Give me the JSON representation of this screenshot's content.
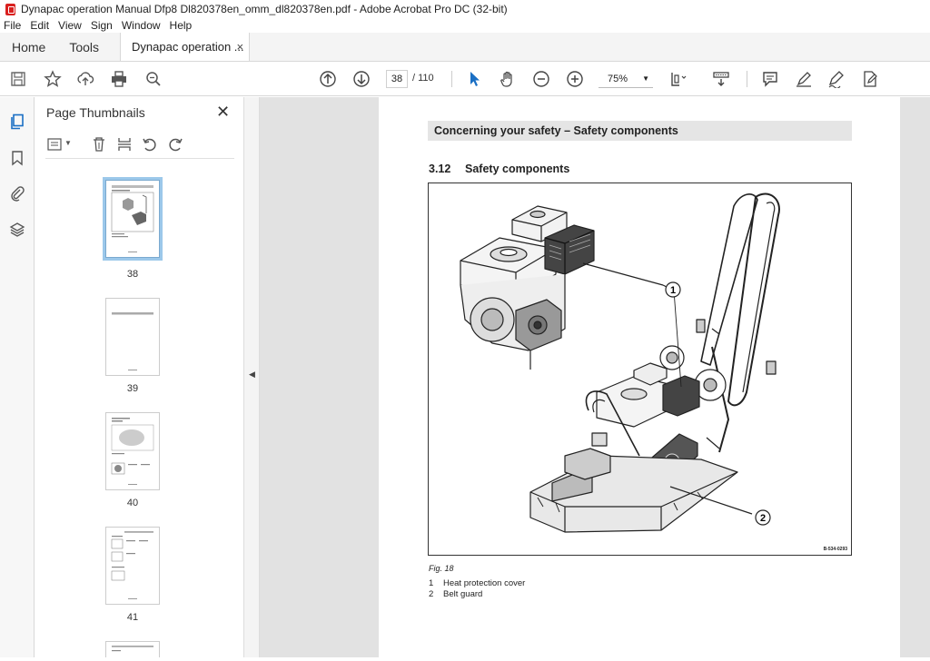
{
  "window": {
    "title": "Dynapac operation Manual Dfp8 Dl820378en_omm_dl820378en.pdf - Adobe Acrobat Pro DC (32-bit)"
  },
  "menu": [
    "File",
    "Edit",
    "View",
    "Sign",
    "Window",
    "Help"
  ],
  "tabs": {
    "home": "Home",
    "tools": "Tools",
    "document": "Dynapac operation ...",
    "close": "×"
  },
  "toolbar": {
    "page_current": "38",
    "page_total": "/ 110",
    "zoom": "75%"
  },
  "panel": {
    "title": "Page Thumbnails",
    "close": "✕",
    "thumbnails": [
      {
        "label": "38",
        "selected": true
      },
      {
        "label": "39",
        "selected": false
      },
      {
        "label": "40",
        "selected": false
      },
      {
        "label": "41",
        "selected": false
      }
    ]
  },
  "document": {
    "header": "Concerning your safety – Safety components",
    "section_number": "3.12",
    "section_title": "Safety components",
    "figure_code": "B-534-0293",
    "figure_caption": "Fig.  18",
    "callouts": [
      "1",
      "2"
    ],
    "legend": [
      {
        "num": "1",
        "text": "Heat protection cover"
      },
      {
        "num": "2",
        "text": "Belt guard"
      }
    ]
  }
}
